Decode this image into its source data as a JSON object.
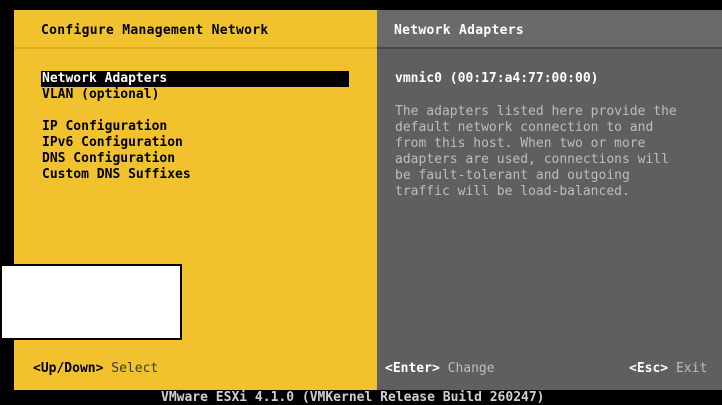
{
  "left_pane": {
    "title": "Configure Management Network",
    "menu": [
      {
        "label": "Network Adapters",
        "selected": true
      },
      {
        "label": "VLAN (optional)"
      },
      {
        "label": "IP Configuration"
      },
      {
        "label": "IPv6 Configuration"
      },
      {
        "label": "DNS Configuration"
      },
      {
        "label": "Custom DNS Suffixes"
      }
    ],
    "footer": {
      "key": "<Up/Down>",
      "action": "Select"
    }
  },
  "right_pane": {
    "title": "Network Adapters",
    "adapter": "vmnic0 (00:17:a4:77:00:00)",
    "description_lines": [
      "The adapters listed here provide the",
      "default network connection to and",
      "from this host. When two or more",
      "adapters are used, connections will",
      "be fault-tolerant and outgoing",
      "traffic will be load-balanced."
    ],
    "footer_enter": {
      "key": "<Enter>",
      "action": "Change"
    },
    "footer_esc": {
      "key": "<Esc>",
      "action": "Exit"
    }
  },
  "status_bar": "VMware ESXi 4.1.0 (VMKernel Release Build 260247)",
  "colors": {
    "left_background": "#f2c12e",
    "right_background": "#5f5f5f",
    "selected_background": "#000000",
    "selected_text": "#ffffff"
  }
}
